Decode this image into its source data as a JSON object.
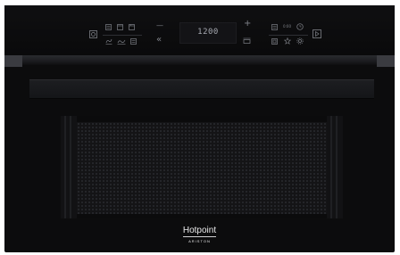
{
  "brand": {
    "name": "Hotpoint",
    "subname": "ARISTON"
  },
  "control_panel": {
    "display_value": "1200",
    "minus_symbol": "—",
    "plus_symbol": "+",
    "back_symbol": "«",
    "clock_label": "0:00",
    "icons": [
      "power-icon",
      "grill-icon",
      "oven-icon",
      "fan-oven-icon",
      "defrost-icon",
      "crisp-icon",
      "menu-icon",
      "minus-icon",
      "back-icon",
      "plus-icon",
      "tray-icon",
      "timer-icon",
      "clock-icon",
      "alarm-icon",
      "weight-icon",
      "favourite-icon",
      "settings-icon",
      "start-icon"
    ]
  },
  "colors": {
    "body": "#0c0c0d",
    "icon": "#7f8289",
    "display_text": "#a7aab2",
    "logo": "#e9e9ea"
  }
}
